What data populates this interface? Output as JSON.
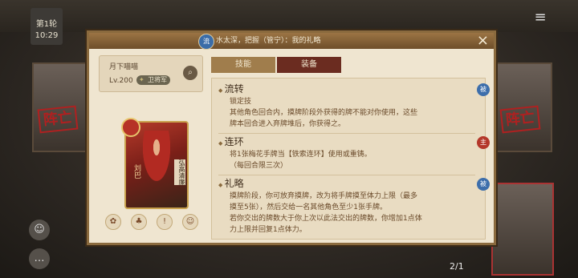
{
  "board": {
    "round": "第1轮",
    "timer": "10:29",
    "card_count": "2/1",
    "dead_label": "阵亡",
    "bottom_buttons": [
      "☺",
      "…",
      "◎"
    ]
  },
  "dialog": {
    "header_badge": "流",
    "header_text": "水太深，把握（管宁）：我的礼略",
    "close_icon": "×"
  },
  "player": {
    "name": "月下喵喵",
    "level": "Lv.200",
    "rank": "卫将军"
  },
  "hero": {
    "name": "刘巴",
    "seal_text": "弘高清廉"
  },
  "tabs": [
    {
      "label": "技能",
      "active": true
    },
    {
      "label": "装备",
      "active": false
    }
  ],
  "skills": [
    {
      "name": "流转",
      "type": "被",
      "color": "#3d6eab",
      "lines": [
        "锁定技",
        "其他角色回合内，摸牌阶段外获得的牌不能对你使用，这些",
        "牌本回合进入弃牌堆后，你获得之。"
      ]
    },
    {
      "name": "连环",
      "type": "主",
      "color": "#b4372a",
      "lines": [
        "将1张梅花手牌当【铁索连环】使用或重铸。",
        "（每回合限三次）"
      ]
    },
    {
      "name": "礼略",
      "type": "被",
      "color": "#3d6eab",
      "lines": [
        "摸牌阶段，你可放弃摸牌，改为将手牌摸至体力上限（最多",
        "摸至5张），然后交给一名其他角色至少1张手牌。",
        "若你交出的牌数大于你上次以此法交出的牌数，你增加1点体",
        "力上限并回复1点体力。"
      ]
    }
  ]
}
